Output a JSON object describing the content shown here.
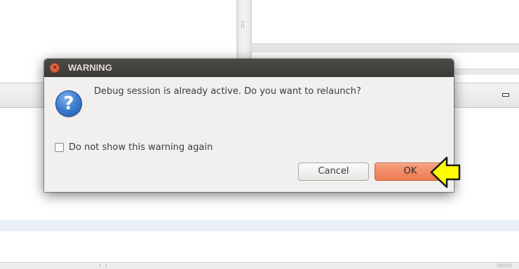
{
  "dialog": {
    "title": "WARNING",
    "message": "Debug session is already active. Do you want to relaunch?",
    "checkbox_label": "Do not show this warning again",
    "checkbox_checked": false,
    "cancel_label": "Cancel",
    "ok_label": "OK",
    "close_symbol": "×",
    "question_symbol": "?"
  },
  "icons": {
    "close": "close-icon",
    "question": "question-icon",
    "annotation": "pointer-arrow-icon"
  },
  "colors": {
    "titlebar": "#3c3b37",
    "dialog_background": "#f1f0ee",
    "ok_button": "#f08a62",
    "close_button": "#e5562b",
    "annotation_arrow": "#ffff00"
  }
}
